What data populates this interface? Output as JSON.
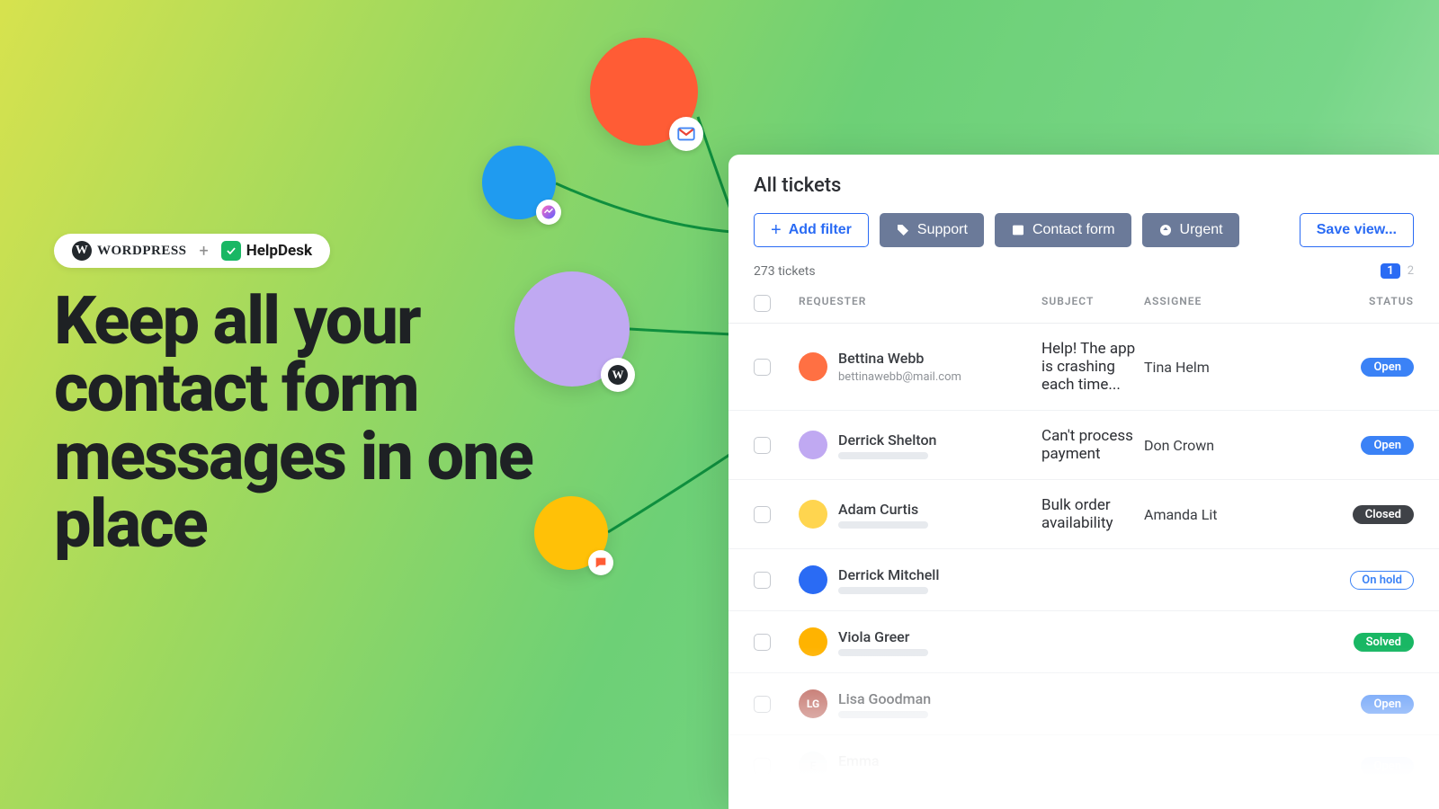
{
  "promo": {
    "wordpress": "WORDPRESS",
    "helpdesk": "HelpDesk",
    "plus": "+",
    "headline": "Keep all your contact form messages in one place"
  },
  "panel": {
    "title": "All tickets",
    "add_filter": "Add filter",
    "chips": {
      "support": "Support",
      "contact_form": "Contact form",
      "urgent": "Urgent"
    },
    "save_view": "Save view...",
    "ticket_count": "273 tickets",
    "page_current": "1",
    "page_next": "2",
    "columns": {
      "requester": "REQUESTER",
      "subject": "SUBJECT",
      "assignee": "ASSIGNEE",
      "status": "STATUS"
    },
    "rows": [
      {
        "name": "Bettina Webb",
        "email": "bettinawebb@mail.com",
        "subject": "Help! The app is crashing each time...",
        "assignee": "Tina Helm",
        "status": "Open",
        "status_kind": "open",
        "avatar_bg": "#ff7043",
        "initials": ""
      },
      {
        "name": "Derrick Shelton",
        "email": "",
        "subject": "Can't process payment",
        "assignee": "Don Crown",
        "status": "Open",
        "status_kind": "open",
        "avatar_bg": "#c0a9f2",
        "initials": ""
      },
      {
        "name": "Adam Curtis",
        "email": "",
        "subject": "Bulk order availability",
        "assignee": "Amanda Lit",
        "status": "Closed",
        "status_kind": "closed",
        "avatar_bg": "#ffd54f",
        "initials": ""
      },
      {
        "name": "Derrick Mitchell",
        "email": "",
        "subject": "",
        "assignee": "",
        "status": "On hold",
        "status_kind": "hold",
        "avatar_bg": "#2a6bf4",
        "initials": ""
      },
      {
        "name": "Viola Greer",
        "email": "",
        "subject": "",
        "assignee": "",
        "status": "Solved",
        "status_kind": "solved",
        "avatar_bg": "#ffb300",
        "initials": ""
      },
      {
        "name": "Lisa Goodman",
        "email": "",
        "subject": "",
        "assignee": "",
        "status": "Open",
        "status_kind": "open",
        "avatar_bg": "#b0453a",
        "initials": "LG"
      },
      {
        "name": "Emma",
        "email": "",
        "subject": "",
        "assignee": "",
        "status": "Open",
        "status_kind": "open faded",
        "avatar_bg": "#d9dde2",
        "initials": "E",
        "faded": true
      }
    ]
  }
}
